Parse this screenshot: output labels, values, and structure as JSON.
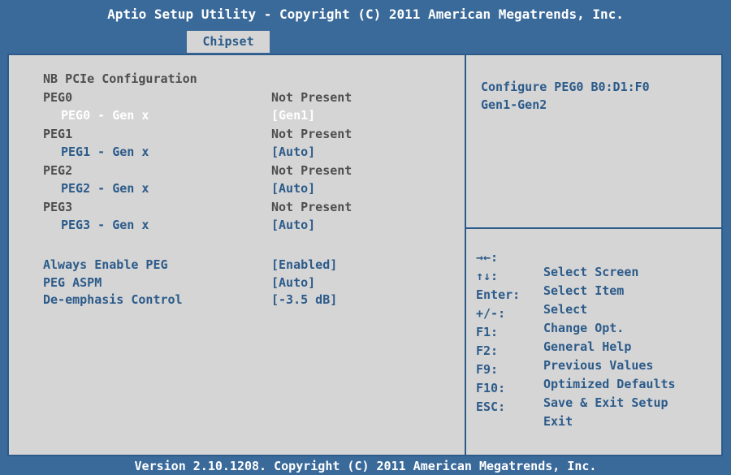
{
  "header": {
    "title": "Aptio Setup Utility - Copyright (C) 2011 American Megatrends, Inc.",
    "tab": "Chipset"
  },
  "left": {
    "section_title": "NB PCIe Configuration",
    "peg0": {
      "label": "PEG0",
      "value": "Not Present"
    },
    "peg0_gen": {
      "label": "PEG0 - Gen x",
      "value": "[Gen1]"
    },
    "peg1": {
      "label": "PEG1",
      "value": "Not Present"
    },
    "peg1_gen": {
      "label": "PEG1 - Gen x",
      "value": "[Auto]"
    },
    "peg2": {
      "label": "PEG2",
      "value": "Not Present"
    },
    "peg2_gen": {
      "label": "PEG2 - Gen x",
      "value": "[Auto]"
    },
    "peg3": {
      "label": "PEG3",
      "value": "Not Present"
    },
    "peg3_gen": {
      "label": "PEG3 - Gen x",
      "value": "[Auto]"
    },
    "always_enable_peg": {
      "label": "Always Enable PEG",
      "value": "[Enabled]"
    },
    "peg_aspm": {
      "label": "PEG ASPM",
      "value": "[Auto]"
    },
    "deemphasis": {
      "label": "De-emphasis Control",
      "value": "[-3.5 dB]"
    }
  },
  "help": {
    "line1": "Configure PEG0 B0:D1:F0",
    "line2": "Gen1-Gen2"
  },
  "keys": [
    {
      "key": "→←:",
      "desc": "Select Screen"
    },
    {
      "key": "↑↓:",
      "desc": "Select Item"
    },
    {
      "key": "Enter:",
      "desc": "Select"
    },
    {
      "key": "+/-:",
      "desc": "Change Opt."
    },
    {
      "key": "F1:",
      "desc": "General Help"
    },
    {
      "key": "F2:",
      "desc": "Previous Values"
    },
    {
      "key": "F9:",
      "desc": "Optimized Defaults"
    },
    {
      "key": "F10:",
      "desc": "Save & Exit Setup"
    },
    {
      "key": "ESC:",
      "desc": "Exit"
    }
  ],
  "footer": {
    "text": "Version 2.10.1208. Copyright (C) 2011 American Megatrends, Inc."
  },
  "colors": {
    "background": "#3a6a9a",
    "panel": "#d5d5d5",
    "accent_blue": "#2c5b8a",
    "text_dark": "#4e4e4e",
    "highlight": "#ffffff"
  }
}
